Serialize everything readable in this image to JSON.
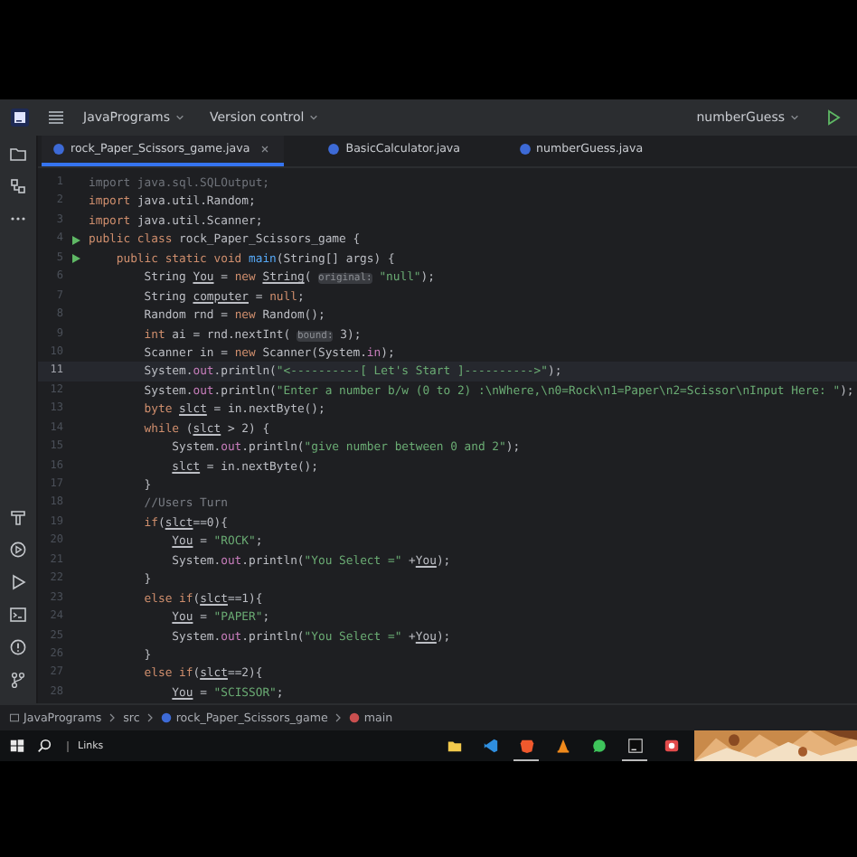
{
  "toolbar": {
    "project": "JavaPrograms",
    "vcs": "Version control",
    "run_config": "numberGuess"
  },
  "tabs": [
    {
      "label": "rock_Paper_Scissors_game.java",
      "selected": true
    },
    {
      "label": "BasicCalculator.java",
      "selected": false
    },
    {
      "label": "numberGuess.java",
      "selected": false
    }
  ],
  "lines": [
    {
      "number": "1",
      "current": false,
      "run": false,
      "tokens": [
        {
          "kind": "unused",
          "text": "import java.sql.SQLOutput;"
        }
      ]
    },
    {
      "number": "2",
      "current": false,
      "run": false,
      "tokens": [
        {
          "kind": "kw",
          "text": "import "
        },
        {
          "kind": "plain",
          "text": "java.util.Random;"
        }
      ]
    },
    {
      "number": "3",
      "current": false,
      "run": false,
      "tokens": [
        {
          "kind": "kw",
          "text": "import "
        },
        {
          "kind": "plain",
          "text": "java.util.Scanner;"
        }
      ]
    },
    {
      "number": "4",
      "current": false,
      "run": true,
      "tokens": [
        {
          "kind": "kw",
          "text": "public class "
        },
        {
          "kind": "plain",
          "text": "rock_Paper_Scissors_game {"
        }
      ]
    },
    {
      "number": "5",
      "current": false,
      "run": true,
      "tokens": [
        {
          "kind": "kw",
          "text": "    public static void "
        },
        {
          "kind": "fn",
          "text": "main"
        },
        {
          "kind": "plain",
          "text": "(String[] args) {"
        }
      ]
    },
    {
      "number": "6",
      "current": false,
      "run": false,
      "tokens": [
        {
          "kind": "plain",
          "text": "        String "
        },
        {
          "kind": "var",
          "text": "You"
        },
        {
          "kind": "plain",
          "text": " = "
        },
        {
          "kind": "kw",
          "text": "new "
        },
        {
          "kind": "var",
          "text": "String"
        },
        {
          "kind": "plain",
          "text": "( "
        },
        {
          "kind": "hint",
          "text": "original:"
        },
        {
          "kind": "str",
          "text": " \"null\""
        },
        {
          "kind": "plain",
          "text": ");"
        }
      ]
    },
    {
      "number": "7",
      "current": false,
      "run": false,
      "tokens": [
        {
          "kind": "plain",
          "text": "        String "
        },
        {
          "kind": "var",
          "text": "computer"
        },
        {
          "kind": "plain",
          "text": " = "
        },
        {
          "kind": "kw",
          "text": "null"
        },
        {
          "kind": "plain",
          "text": ";"
        }
      ]
    },
    {
      "number": "8",
      "current": false,
      "run": false,
      "tokens": [
        {
          "kind": "plain",
          "text": "        Random rnd = "
        },
        {
          "kind": "kw",
          "text": "new "
        },
        {
          "kind": "plain",
          "text": "Random();"
        }
      ]
    },
    {
      "number": "9",
      "current": false,
      "run": false,
      "tokens": [
        {
          "kind": "kw",
          "text": "        int "
        },
        {
          "kind": "plain",
          "text": "ai = rnd.nextInt( "
        },
        {
          "kind": "hint",
          "text": "bound:"
        },
        {
          "kind": "plain",
          "text": " 3);"
        }
      ]
    },
    {
      "number": "10",
      "current": false,
      "run": false,
      "tokens": [
        {
          "kind": "plain",
          "text": "        Scanner in = "
        },
        {
          "kind": "kw",
          "text": "new "
        },
        {
          "kind": "plain",
          "text": "Scanner(System."
        },
        {
          "kind": "field",
          "text": "in"
        },
        {
          "kind": "plain",
          "text": ");"
        }
      ]
    },
    {
      "number": "11",
      "current": true,
      "run": false,
      "tokens": [
        {
          "kind": "plain",
          "text": "        System."
        },
        {
          "kind": "field",
          "text": "out"
        },
        {
          "kind": "plain",
          "text": ".println("
        },
        {
          "kind": "str",
          "text": "\"<----------[ Let's Start ]---------->\""
        },
        {
          "kind": "plain",
          "text": ");"
        }
      ]
    },
    {
      "number": "12",
      "current": false,
      "run": false,
      "tokens": [
        {
          "kind": "plain",
          "text": "        System."
        },
        {
          "kind": "field",
          "text": "out"
        },
        {
          "kind": "plain",
          "text": ".println("
        },
        {
          "kind": "str",
          "text": "\"Enter a number b/w (0 to 2) :\\nWhere,\\n0=Rock\\n1=Paper\\n2=Scissor\\nInput Here: \""
        },
        {
          "kind": "plain",
          "text": ");"
        }
      ]
    },
    {
      "number": "13",
      "current": false,
      "run": false,
      "tokens": [
        {
          "kind": "kw",
          "text": "        byte "
        },
        {
          "kind": "var",
          "text": "slct"
        },
        {
          "kind": "plain",
          "text": " = in.nextByte();"
        }
      ]
    },
    {
      "number": "14",
      "current": false,
      "run": false,
      "tokens": [
        {
          "kind": "kw",
          "text": "        while "
        },
        {
          "kind": "plain",
          "text": "("
        },
        {
          "kind": "var",
          "text": "slct"
        },
        {
          "kind": "plain",
          "text": " > 2) {"
        }
      ]
    },
    {
      "number": "15",
      "current": false,
      "run": false,
      "tokens": [
        {
          "kind": "plain",
          "text": "            System."
        },
        {
          "kind": "field",
          "text": "out"
        },
        {
          "kind": "plain",
          "text": ".println("
        },
        {
          "kind": "str",
          "text": "\"give number between 0 and 2\""
        },
        {
          "kind": "plain",
          "text": ");"
        }
      ]
    },
    {
      "number": "16",
      "current": false,
      "run": false,
      "tokens": [
        {
          "kind": "var",
          "text": "            slct"
        },
        {
          "kind": "plain",
          "text": " = in.nextByte();"
        }
      ]
    },
    {
      "number": "17",
      "current": false,
      "run": false,
      "tokens": [
        {
          "kind": "plain",
          "text": "        }"
        }
      ]
    },
    {
      "number": "18",
      "current": false,
      "run": false,
      "tokens": [
        {
          "kind": "comment",
          "text": "        //Users Turn"
        }
      ]
    },
    {
      "number": "19",
      "current": false,
      "run": false,
      "tokens": [
        {
          "kind": "kw",
          "text": "        if"
        },
        {
          "kind": "plain",
          "text": "("
        },
        {
          "kind": "var",
          "text": "slct"
        },
        {
          "kind": "plain",
          "text": "==0){"
        }
      ]
    },
    {
      "number": "20",
      "current": false,
      "run": false,
      "tokens": [
        {
          "kind": "var",
          "text": "            You"
        },
        {
          "kind": "plain",
          "text": " = "
        },
        {
          "kind": "str",
          "text": "\"ROCK\""
        },
        {
          "kind": "plain",
          "text": ";"
        }
      ]
    },
    {
      "number": "21",
      "current": false,
      "run": false,
      "tokens": [
        {
          "kind": "plain",
          "text": "            System."
        },
        {
          "kind": "field",
          "text": "out"
        },
        {
          "kind": "plain",
          "text": ".println("
        },
        {
          "kind": "str",
          "text": "\"You Select =\""
        },
        {
          "kind": "plain",
          "text": " +"
        },
        {
          "kind": "var",
          "text": "You"
        },
        {
          "kind": "plain",
          "text": ");"
        }
      ]
    },
    {
      "number": "22",
      "current": false,
      "run": false,
      "tokens": [
        {
          "kind": "plain",
          "text": "        }"
        }
      ]
    },
    {
      "number": "23",
      "current": false,
      "run": false,
      "tokens": [
        {
          "kind": "kw",
          "text": "        else if"
        },
        {
          "kind": "plain",
          "text": "("
        },
        {
          "kind": "var",
          "text": "slct"
        },
        {
          "kind": "plain",
          "text": "==1){"
        }
      ]
    },
    {
      "number": "24",
      "current": false,
      "run": false,
      "tokens": [
        {
          "kind": "var",
          "text": "            You"
        },
        {
          "kind": "plain",
          "text": " = "
        },
        {
          "kind": "str",
          "text": "\"PAPER\""
        },
        {
          "kind": "plain",
          "text": ";"
        }
      ]
    },
    {
      "number": "25",
      "current": false,
      "run": false,
      "tokens": [
        {
          "kind": "plain",
          "text": "            System."
        },
        {
          "kind": "field",
          "text": "out"
        },
        {
          "kind": "plain",
          "text": ".println("
        },
        {
          "kind": "str",
          "text": "\"You Select =\""
        },
        {
          "kind": "plain",
          "text": " +"
        },
        {
          "kind": "var",
          "text": "You"
        },
        {
          "kind": "plain",
          "text": ");"
        }
      ]
    },
    {
      "number": "26",
      "current": false,
      "run": false,
      "tokens": [
        {
          "kind": "plain",
          "text": "        }"
        }
      ]
    },
    {
      "number": "27",
      "current": false,
      "run": false,
      "tokens": [
        {
          "kind": "kw",
          "text": "        else if"
        },
        {
          "kind": "plain",
          "text": "("
        },
        {
          "kind": "var",
          "text": "slct"
        },
        {
          "kind": "plain",
          "text": "==2){"
        }
      ]
    },
    {
      "number": "28",
      "current": false,
      "run": false,
      "tokens": [
        {
          "kind": "var",
          "text": "            You"
        },
        {
          "kind": "plain",
          "text": " = "
        },
        {
          "kind": "str",
          "text": "\"SCISSOR\""
        },
        {
          "kind": "plain",
          "text": ";"
        }
      ]
    }
  ],
  "breadcrumb": [
    {
      "label": "JavaPrograms",
      "kind": "module"
    },
    {
      "label": "src",
      "kind": "folder"
    },
    {
      "label": "rock_Paper_Scissors_game",
      "kind": "class"
    },
    {
      "label": "main",
      "kind": "method"
    }
  ],
  "taskbar": {
    "search_label": "Links",
    "apps": [
      {
        "kind": "explorer",
        "selected": false
      },
      {
        "kind": "vscode",
        "selected": false
      },
      {
        "kind": "brave",
        "selected": true
      },
      {
        "kind": "vlc",
        "selected": false
      },
      {
        "kind": "whatsapp",
        "selected": false
      },
      {
        "kind": "intellij",
        "selected": true
      },
      {
        "kind": "recorder",
        "selected": false
      }
    ]
  }
}
